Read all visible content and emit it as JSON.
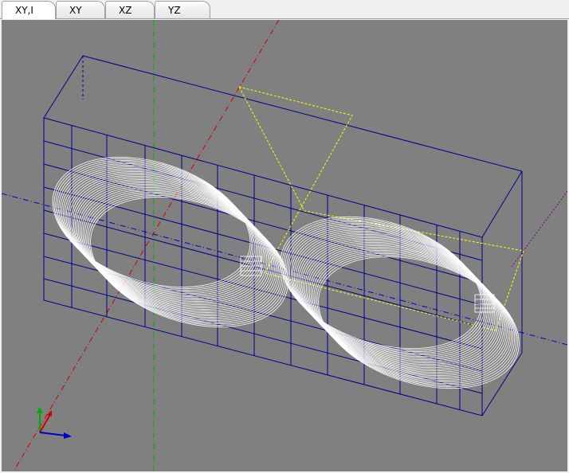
{
  "tabs": [
    {
      "label": "XY,I",
      "active": true
    },
    {
      "label": "XY",
      "active": false
    },
    {
      "label": "XZ",
      "active": false
    },
    {
      "label": "YZ",
      "active": false
    }
  ],
  "viewport": {
    "background": "#808080",
    "colors": {
      "wireframe": "#00008b",
      "x_axis": "#cc0000",
      "y_axis": "#00aa00",
      "z_axis": "#0000cc",
      "selection_box": "#ffff00",
      "toolpath": "#ffffff",
      "diagonal": "#7a007a"
    },
    "triad_icon": "xyz-axis-triad-icon"
  }
}
